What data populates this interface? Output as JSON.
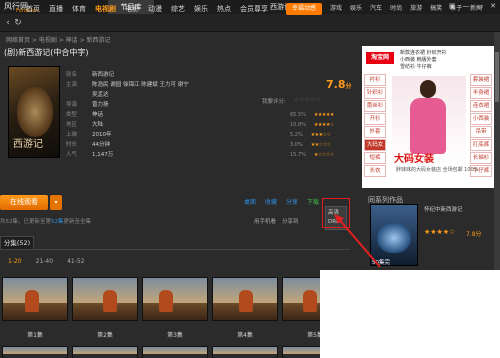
{
  "app": {
    "brand_name": "风行网",
    "brand_sub": "Funshion",
    "tab_label": "节目库",
    "title": "西游记",
    "window_buttons": [
      "▣",
      "—",
      "▭",
      "✕"
    ]
  },
  "nav": {
    "items": [
      {
        "label": "首页",
        "active": false
      },
      {
        "label": "直播",
        "active": false
      },
      {
        "label": "体育",
        "active": false
      },
      {
        "label": "电视剧",
        "active": true
      },
      {
        "label": "电影",
        "active": false
      },
      {
        "label": "动漫",
        "active": false
      },
      {
        "label": "综艺",
        "active": false
      },
      {
        "label": "娱乐",
        "active": false
      },
      {
        "label": "热点",
        "active": false
      },
      {
        "label": "会员尊享",
        "active": false
      }
    ],
    "special": "幸福动感",
    "right_items": [
      "游戏",
      "娱乐",
      "汽车",
      "时尚",
      "旅游",
      "搞笑",
      "亲子",
      "新闻"
    ],
    "icons": [
      "back-icon",
      "forward-icon",
      "refresh-icon",
      "home-icon"
    ]
  },
  "breadcrumb": "网络首页 > 电视剧 > 神话 > 新西游记",
  "movie": {
    "title": "(剧)新西游记(中合中字)",
    "poster_text": "西游记",
    "info": [
      {
        "k": "别名",
        "v": "新西游记"
      },
      {
        "k": "主演",
        "v": "陈浩民 谢园 徐锦江 陈建斌 王力可 谢宁"
      },
      {
        "k": "",
        "v": "吴孟达"
      },
      {
        "k": "导演",
        "v": "曾力扬"
      },
      {
        "k": "类型",
        "v": "神话"
      },
      {
        "k": "地区",
        "v": "大陆"
      },
      {
        "k": "上映",
        "v": "2010年"
      },
      {
        "k": "时长",
        "v": "44分钟"
      },
      {
        "k": "人气",
        "v": "1,147万"
      }
    ],
    "rating": "7.8",
    "rating_suffix": "分",
    "rate_label": "我要评分:",
    "rate_stars": "☆☆☆☆☆",
    "distribution": [
      {
        "pct": "65.5%",
        "stars": "★★★★★"
      },
      {
        "pct": "10.8%",
        "stars": "★★★★☆"
      },
      {
        "pct": "5.2%",
        "stars": "★★★☆☆"
      },
      {
        "pct": "3.0%",
        "stars": "★★☆☆☆"
      },
      {
        "pct": "15.7%",
        "stars": "★☆☆☆☆"
      }
    ]
  },
  "actions": {
    "watch": "在线观看",
    "dropdown": "▾",
    "notice_pre": "共52集，已更新至第",
    "notice_hl": "52集",
    "notice_post": "更新至全集",
    "links": [
      "桌面",
      "收藏",
      "分享"
    ],
    "download": "下载",
    "download_menu": [
      "高清",
      "DRK"
    ],
    "tools": [
      "用手机看",
      "分享到"
    ]
  },
  "episodes": {
    "tab": "分集(52)",
    "ranges": [
      {
        "label": "1-20",
        "active": true
      },
      {
        "label": "21-40",
        "active": false
      },
      {
        "label": "41-52",
        "active": false
      }
    ],
    "items": [
      "第1集",
      "第2集",
      "第3集",
      "第4集",
      "第5集"
    ]
  },
  "ad": {
    "logo": "淘宝网",
    "top_links": [
      "新款连衣裙 针织开衫",
      "小西装 韩版外套",
      "雪纺衫 牛仔裤"
    ],
    "categories_left": [
      "衬衫",
      "针织衫",
      "蕾丝衫",
      "开衫",
      "外套",
      "大码女",
      "短裤",
      "长衣"
    ],
    "categories_right": [
      "套装裙",
      "半身裙",
      "连衣裙",
      "小西装",
      "吊带",
      "打底裤",
      "长袖衫",
      "牛仔裤"
    ],
    "slogan": "大码女装",
    "sub": "胖妹妹的大码女装店 全场包邮 100%"
  },
  "related": {
    "heading": "同系列作品",
    "title": "怀纪中新西游记",
    "stars": "★★★★☆",
    "score": "7.8分",
    "count": "50集完"
  }
}
